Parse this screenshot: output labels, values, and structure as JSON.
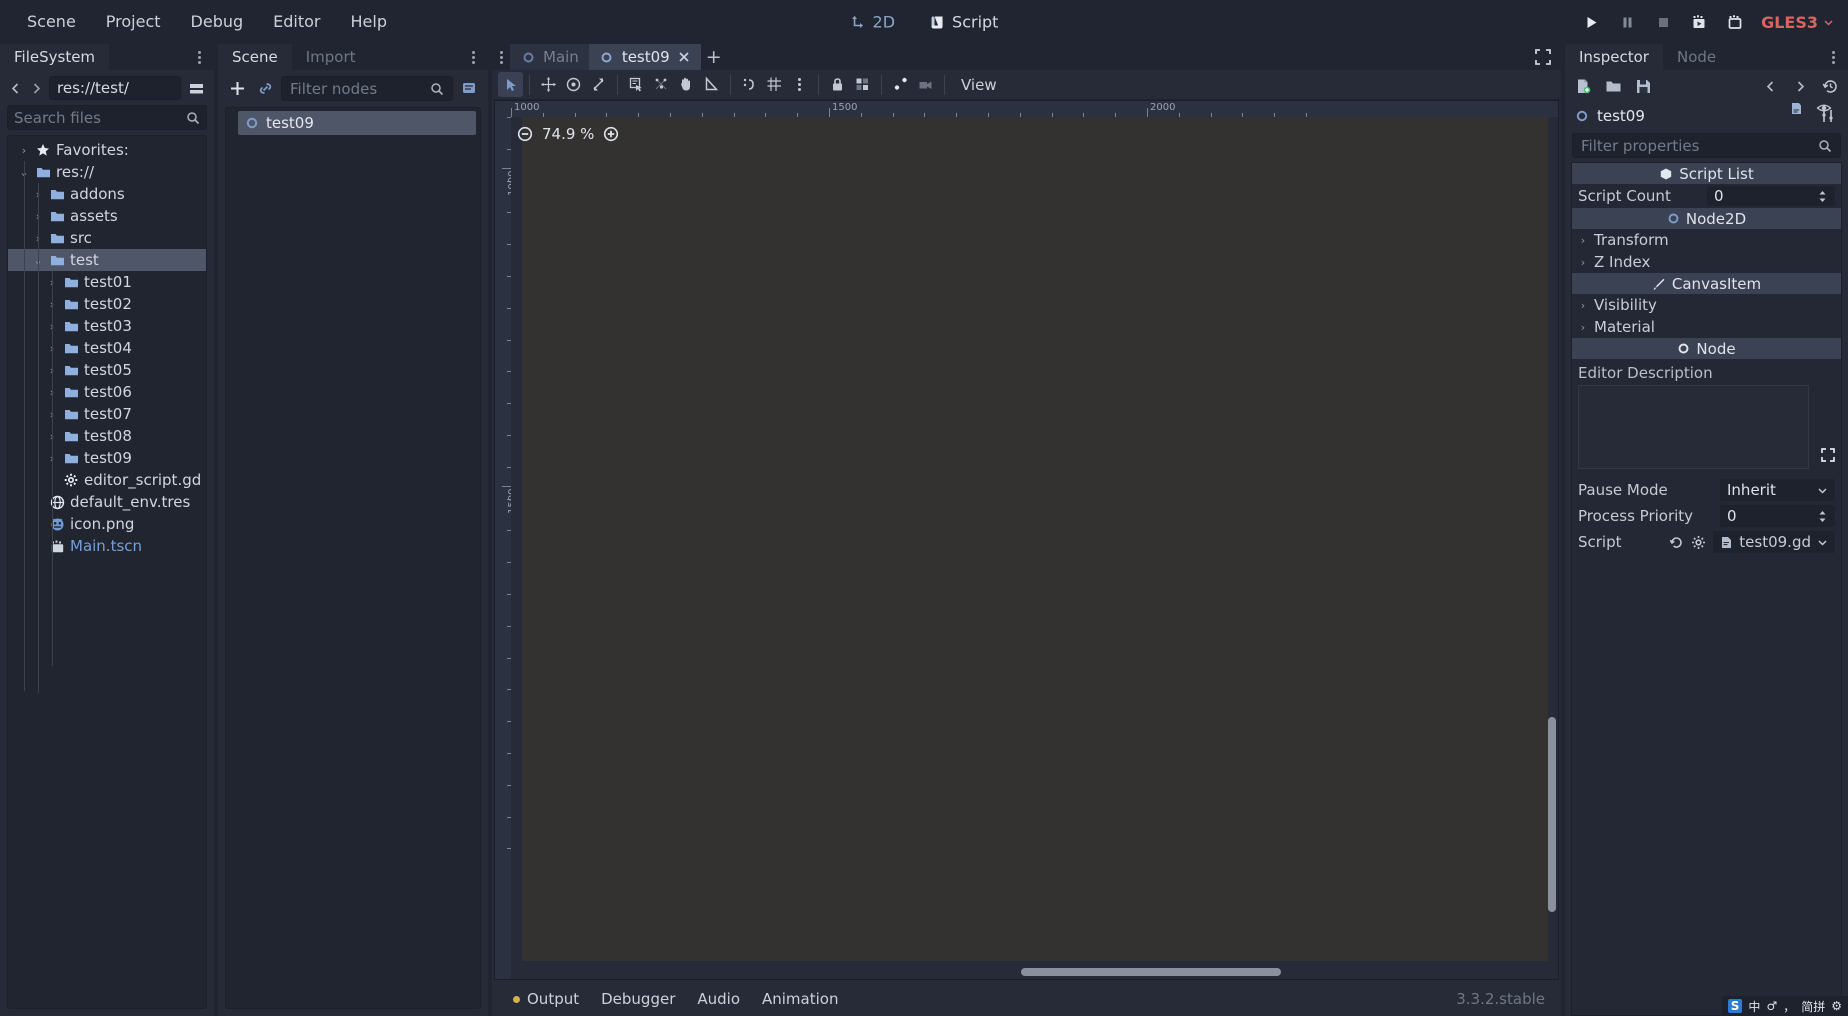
{
  "menubar": {
    "items": [
      {
        "label": "Scene"
      },
      {
        "label": "Project"
      },
      {
        "label": "Debug"
      },
      {
        "label": "Editor"
      },
      {
        "label": "Help"
      }
    ],
    "center_tabs": [
      {
        "label": "2D",
        "icon": "move-2d-icon",
        "active": true
      },
      {
        "label": "Script",
        "icon": "script-scroll-icon",
        "active": false
      }
    ],
    "playback": [
      {
        "name": "play-button",
        "icon": "play-icon"
      },
      {
        "name": "pause-button",
        "icon": "pause-icon"
      },
      {
        "name": "stop-button",
        "icon": "stop-icon"
      },
      {
        "name": "play-scene-button",
        "icon": "play-scene-icon"
      },
      {
        "name": "play-custom-scene-button",
        "icon": "play-custom-icon"
      }
    ],
    "renderer": {
      "label": "GLES3",
      "color": "#d8655f"
    }
  },
  "filesystem": {
    "tabs": [
      {
        "label": "FileSystem",
        "active": true
      }
    ],
    "path": "res://test/",
    "search_placeholder": "Search files",
    "tree": [
      {
        "label": "Favorites:",
        "icon": "star-icon",
        "indent": 0,
        "twist": "right",
        "selected": false
      },
      {
        "label": "res://",
        "icon": "folder-icon",
        "indent": 0,
        "twist": "down",
        "selected": false
      },
      {
        "label": "addons",
        "icon": "folder-icon",
        "indent": 1,
        "twist": "right",
        "selected": false
      },
      {
        "label": "assets",
        "icon": "folder-icon",
        "indent": 1,
        "twist": "right",
        "selected": false
      },
      {
        "label": "src",
        "icon": "folder-icon",
        "indent": 1,
        "twist": "right",
        "selected": false
      },
      {
        "label": "test",
        "icon": "folder-icon",
        "indent": 1,
        "twist": "down",
        "selected": true
      },
      {
        "label": "test01",
        "icon": "folder-icon",
        "indent": 2,
        "twist": "right",
        "selected": false
      },
      {
        "label": "test02",
        "icon": "folder-icon",
        "indent": 2,
        "twist": "right",
        "selected": false
      },
      {
        "label": "test03",
        "icon": "folder-icon",
        "indent": 2,
        "twist": "right",
        "selected": false
      },
      {
        "label": "test04",
        "icon": "folder-icon",
        "indent": 2,
        "twist": "right",
        "selected": false
      },
      {
        "label": "test05",
        "icon": "folder-icon",
        "indent": 2,
        "twist": "right",
        "selected": false
      },
      {
        "label": "test06",
        "icon": "folder-icon",
        "indent": 2,
        "twist": "right",
        "selected": false
      },
      {
        "label": "test07",
        "icon": "folder-icon",
        "indent": 2,
        "twist": "right",
        "selected": false
      },
      {
        "label": "test08",
        "icon": "folder-icon",
        "indent": 2,
        "twist": "right",
        "selected": false
      },
      {
        "label": "test09",
        "icon": "folder-icon",
        "indent": 2,
        "twist": "right",
        "selected": false
      },
      {
        "label": "editor_script.gd",
        "icon": "gdscript-gear-icon",
        "indent": 2,
        "twist": "none",
        "selected": false
      },
      {
        "label": "default_env.tres",
        "icon": "environment-globe-icon",
        "indent": 1,
        "twist": "none",
        "selected": false
      },
      {
        "label": "icon.png",
        "icon": "image-texture-icon",
        "indent": 1,
        "twist": "none",
        "selected": false
      },
      {
        "label": "Main.tscn",
        "icon": "packed-scene-icon",
        "indent": 1,
        "twist": "none",
        "selected": false,
        "blue": true
      }
    ]
  },
  "scene_dock": {
    "tabs": [
      {
        "label": "Scene",
        "active": true
      },
      {
        "label": "Import",
        "active": false
      }
    ],
    "toolbar": [
      {
        "name": "add-node-button",
        "icon": "plus-icon"
      },
      {
        "name": "instance-scene-button",
        "icon": "link-chain-icon"
      }
    ],
    "filter_placeholder": "Filter nodes",
    "nodes": [
      {
        "label": "test09",
        "icon": "node2d-icon",
        "selected": true
      }
    ]
  },
  "viewport": {
    "scene_tabs": [
      {
        "label": "Main",
        "icon": "node2d-icon",
        "active": false,
        "closable": false
      },
      {
        "label": "test09",
        "icon": "node2d-icon",
        "active": true,
        "closable": true
      }
    ],
    "add_tab_label": "+",
    "toolbar": [
      {
        "name": "select-mode-tool",
        "icon": "cursor-arrow-icon",
        "active": true
      },
      {
        "name": "move-mode-tool",
        "icon": "move-cross-icon",
        "active": false
      },
      {
        "name": "rotate-mode-tool",
        "icon": "rotate-circle-icon",
        "active": false
      },
      {
        "name": "scale-mode-tool",
        "icon": "scale-arrows-icon",
        "active": false
      },
      {
        "name": "list-select-tool",
        "icon": "list-select-icon",
        "active": false
      },
      {
        "name": "ruler-mode-tool",
        "icon": "pivot-point-icon",
        "active": false
      },
      {
        "name": "pan-mode-tool",
        "icon": "pan-hand-icon",
        "active": false
      },
      {
        "name": "ruler-tool",
        "icon": "ruler-triangle-icon",
        "active": false
      },
      {
        "name": "toggle-smart-snap",
        "icon": "smart-snap-icon",
        "active": false
      },
      {
        "name": "toggle-grid-snap",
        "icon": "grid-snap-icon",
        "active": false
      },
      {
        "name": "snap-options-menu",
        "icon": "vertical-dots-icon",
        "active": false
      },
      {
        "name": "lock-selected-button",
        "icon": "lock-icon",
        "active": false
      },
      {
        "name": "group-selected-button",
        "icon": "group-icon",
        "active": false
      },
      {
        "name": "skeleton-options-button",
        "icon": "bone-icon",
        "active": false
      },
      {
        "name": "camera-override-button",
        "icon": "camera-icon",
        "active": false
      }
    ],
    "view_menu_label": "View",
    "zoom_level": "74.9 %",
    "zoom_out_label": "−",
    "zoom_in_label": "+",
    "ruler_labels_h": [
      "1000",
      "1500",
      "2000"
    ],
    "ruler_labels_v": [
      "1000",
      "1500"
    ]
  },
  "bottom_panel": {
    "items": [
      {
        "label": "Output",
        "dot": true
      },
      {
        "label": "Debugger",
        "dot": false
      },
      {
        "label": "Audio",
        "dot": false
      },
      {
        "label": "Animation",
        "dot": false
      }
    ],
    "version": "3.3.2.stable"
  },
  "inspector": {
    "tabs": [
      {
        "label": "Inspector",
        "active": true
      },
      {
        "label": "Node",
        "active": false
      }
    ],
    "toolbar": [
      {
        "name": "new-resource-button",
        "icon": "new-file-icon"
      },
      {
        "name": "load-resource-button",
        "icon": "open-folder-icon"
      },
      {
        "name": "save-resource-button",
        "icon": "save-disk-icon"
      },
      {
        "name": "history-prev-button",
        "icon": "chevron-left-icon"
      },
      {
        "name": "history-next-button",
        "icon": "chevron-right-icon"
      },
      {
        "name": "history-menu-button",
        "icon": "history-clock-icon"
      }
    ],
    "object_name": "test09",
    "object_icon": "node2d-icon",
    "object_tools_icon": "object-tools-icon",
    "filter_placeholder": "Filter properties",
    "sections": [
      {
        "type": "category",
        "label": "Script List",
        "icon": "script-list-icon"
      },
      {
        "type": "property",
        "label": "Script Count",
        "value": "0",
        "control": "spinbox"
      },
      {
        "type": "category",
        "label": "Node2D",
        "icon": "node2d-icon"
      },
      {
        "type": "subsection",
        "label": "Transform"
      },
      {
        "type": "subsection",
        "label": "Z Index"
      },
      {
        "type": "category",
        "label": "CanvasItem",
        "icon": "canvasitem-brush-icon"
      },
      {
        "type": "subsection",
        "label": "Visibility"
      },
      {
        "type": "subsection",
        "label": "Material"
      },
      {
        "type": "category",
        "label": "Node",
        "icon": "node-icon"
      }
    ],
    "editor_description_label": "Editor Description",
    "editor_description_value": "",
    "expand_icon": "expand-arrows-icon",
    "bottom_properties": [
      {
        "label": "Pause Mode",
        "value": "Inherit",
        "control": "dropdown"
      },
      {
        "label": "Process Priority",
        "value": "0",
        "control": "spinbox"
      },
      {
        "label": "Script",
        "value": "test09.gd",
        "control": "script",
        "revert_icon": "revert-arrow-icon",
        "gear_icon": "gear-icon",
        "script_icon": "gdscript-file-icon"
      }
    ]
  },
  "taskbar": {
    "ime": [
      {
        "label": "S",
        "type": "logo"
      },
      {
        "label": "中"
      },
      {
        "label": "♂"
      },
      {
        "label": "，"
      },
      {
        "label": "简拼"
      },
      {
        "label": "⚙"
      }
    ]
  }
}
